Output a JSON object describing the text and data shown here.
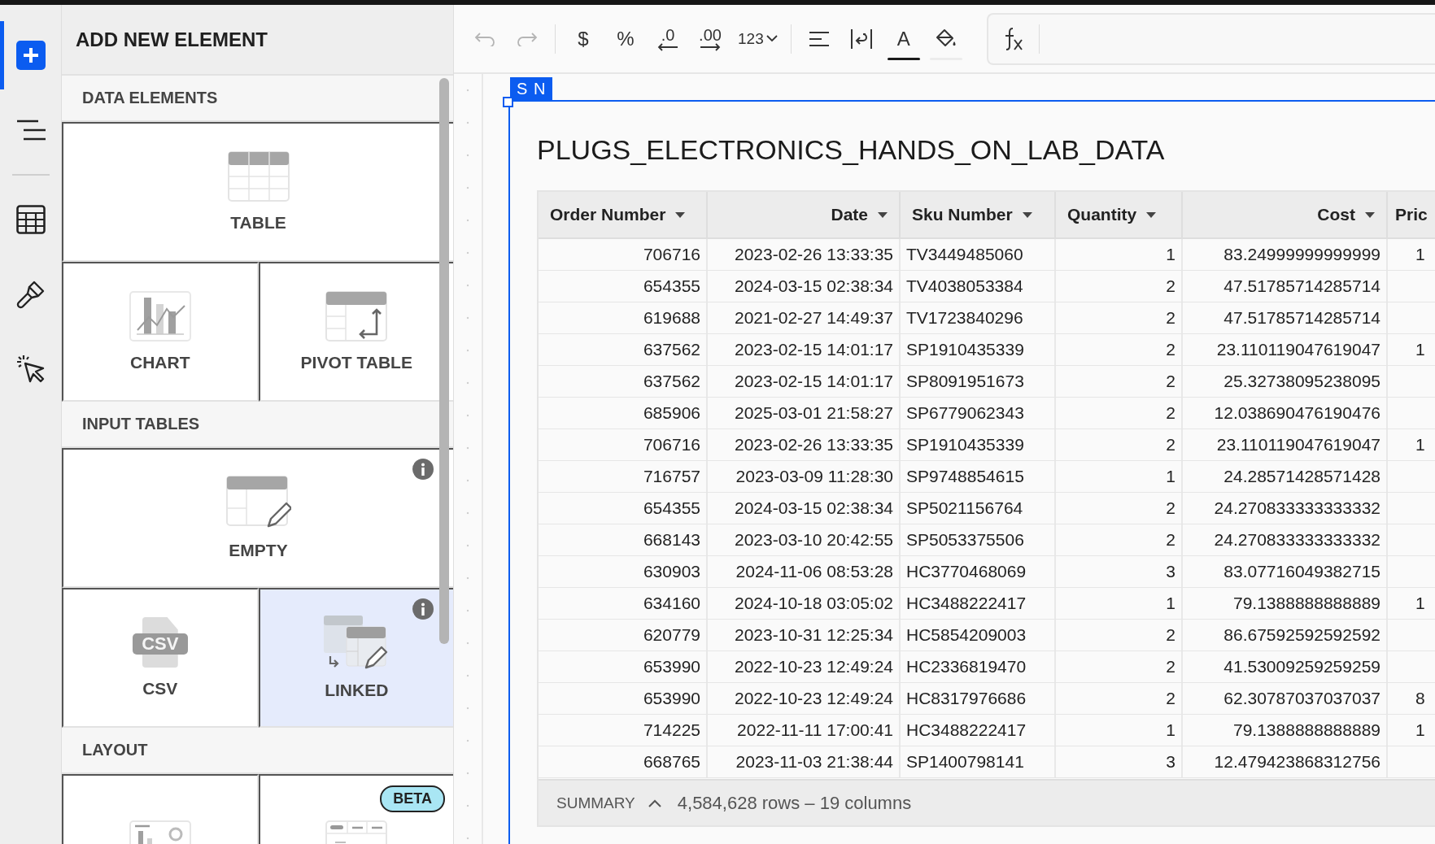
{
  "rail": [
    {
      "kind": "add",
      "selected": true
    },
    {
      "kind": "outline",
      "selected": false
    },
    {
      "kind": "separator"
    },
    {
      "kind": "table",
      "selected": false
    },
    {
      "kind": "brush",
      "selected": false
    },
    {
      "kind": "cursor",
      "selected": false
    }
  ],
  "panel": {
    "title": "ADD NEW ELEMENT",
    "sections": [
      {
        "title": "DATA ELEMENTS",
        "rows": [
          [
            {
              "label": "TABLE",
              "kind": "table",
              "selected": false,
              "info": false
            }
          ],
          [
            {
              "label": "CHART",
              "kind": "chart",
              "selected": false,
              "info": false
            },
            {
              "label": "PIVOT TABLE",
              "kind": "pivot",
              "selected": false,
              "info": false
            }
          ]
        ]
      },
      {
        "title": "INPUT TABLES",
        "rows": [
          [
            {
              "label": "EMPTY",
              "kind": "empty",
              "selected": false,
              "info": true
            }
          ],
          [
            {
              "label": "CSV",
              "kind": "csv",
              "icon_text": "CSV",
              "selected": false,
              "info": false
            },
            {
              "label": "LINKED",
              "kind": "linked",
              "selected": true,
              "info": true
            }
          ]
        ]
      },
      {
        "title": "LAYOUT",
        "rows": [
          [
            {
              "kind": "dashboard",
              "selected": false,
              "info": false
            },
            {
              "kind": "tabs",
              "selected": false,
              "info": false,
              "badge": "BETA"
            }
          ]
        ]
      }
    ]
  },
  "toolbar": [
    {
      "kind": "undo",
      "disabled": true
    },
    {
      "kind": "redo",
      "disabled": true
    },
    {
      "kind": "separator"
    },
    {
      "kind": "text",
      "label": "$",
      "disabled": false
    },
    {
      "kind": "text",
      "label": "%",
      "disabled": false
    },
    {
      "kind": "decimals-less",
      "label": ".0",
      "disabled": false
    },
    {
      "kind": "decimals-more",
      "label": ".00",
      "disabled": false
    },
    {
      "kind": "dropdown",
      "label": "123",
      "disabled": false
    },
    {
      "kind": "separator"
    },
    {
      "kind": "align",
      "disabled": false
    },
    {
      "kind": "wrap",
      "disabled": false
    },
    {
      "kind": "text-color",
      "label": "A",
      "disabled": false
    },
    {
      "kind": "fill-color",
      "disabled": false
    }
  ],
  "element": {
    "tag": "S N",
    "title": "PLUGS_ELECTRONICS_HANDS_ON_LAB_DATA",
    "table": {
      "columns": [
        {
          "label": "Order Number",
          "filter": true
        },
        {
          "label": "Date",
          "filter": true
        },
        {
          "label": "Sku Number",
          "filter": true
        },
        {
          "label": "Quantity",
          "filter": true
        },
        {
          "label": "Cost",
          "filter": true
        },
        {
          "label": "Pric"
        }
      ],
      "rows": [
        [
          "706716",
          "2023-02-26 13:33:35",
          "TV3449485060",
          "1",
          "83.24999999999999",
          "1"
        ],
        [
          "654355",
          "2024-03-15 02:38:34",
          "TV4038053384",
          "2",
          "47.51785714285714"
        ],
        [
          "619688",
          "2021-02-27 14:49:37",
          "TV1723840296",
          "2",
          "47.51785714285714"
        ],
        [
          "637562",
          "2023-02-15 14:01:17",
          "SP1910435339",
          "2",
          "23.110119047619047",
          "1"
        ],
        [
          "637562",
          "2023-02-15 14:01:17",
          "SP8091951673",
          "2",
          "25.32738095238095"
        ],
        [
          "685906",
          "2025-03-01 21:58:27",
          "SP6779062343",
          "2",
          "12.038690476190476"
        ],
        [
          "706716",
          "2023-02-26 13:33:35",
          "SP1910435339",
          "2",
          "23.110119047619047",
          "1"
        ],
        [
          "716757",
          "2023-03-09 11:28:30",
          "SP9748854615",
          "1",
          "24.28571428571428"
        ],
        [
          "654355",
          "2024-03-15 02:38:34",
          "SP5021156764",
          "2",
          "24.270833333333332"
        ],
        [
          "668143",
          "2023-03-10 20:42:55",
          "SP5053375506",
          "2",
          "24.270833333333332"
        ],
        [
          "630903",
          "2024-11-06 08:53:28",
          "HC3770468069",
          "3",
          "83.07716049382715"
        ],
        [
          "634160",
          "2024-10-18 03:05:02",
          "HC3488222417",
          "1",
          "79.1388888888889",
          "1"
        ],
        [
          "620779",
          "2023-10-31 12:25:34",
          "HC5854209003",
          "2",
          "86.67592592592592"
        ],
        [
          "653990",
          "2022-10-23 12:49:24",
          "HC2336819470",
          "2",
          "41.53009259259259"
        ],
        [
          "653990",
          "2022-10-23 12:49:24",
          "HC8317976686",
          "2",
          "62.30787037037037",
          "8"
        ],
        [
          "714225",
          "2022-11-11 17:00:41",
          "HC3488222417",
          "1",
          "79.1388888888889",
          "1"
        ],
        [
          "668765",
          "2023-11-03 21:38:44",
          "SP1400798141",
          "3",
          "12.479423868312756"
        ]
      ],
      "summary": {
        "label": "SUMMARY",
        "text": "4,584,628 rows – 19 columns"
      }
    }
  }
}
